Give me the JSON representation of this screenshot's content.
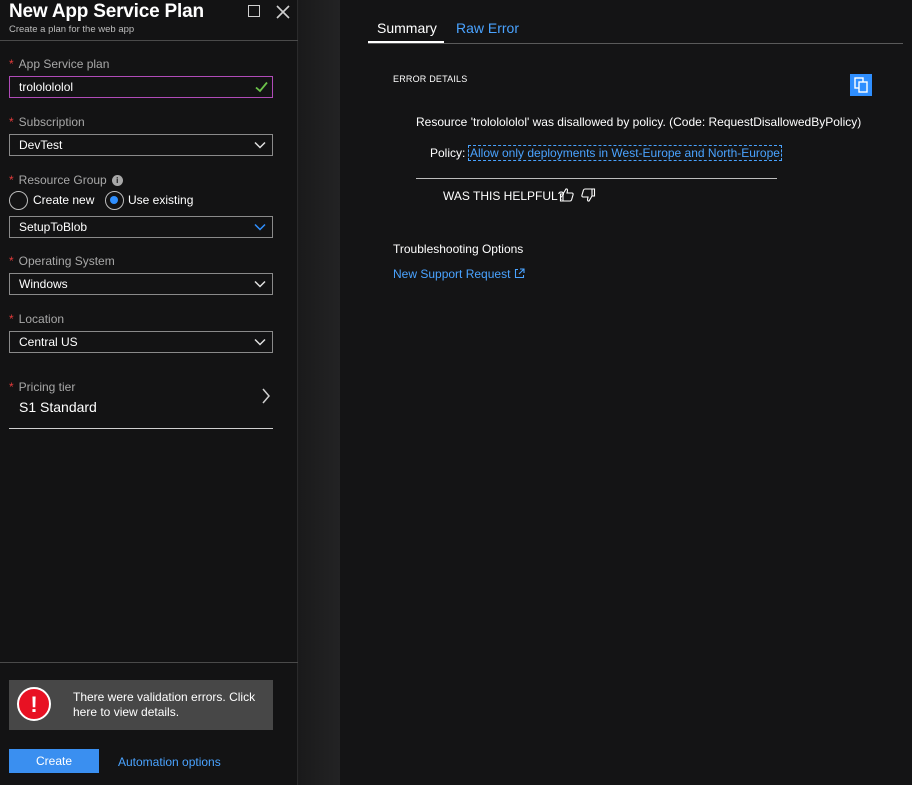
{
  "blade": {
    "title": "New App Service Plan",
    "subtitle": "Create a plan for the web app"
  },
  "form": {
    "plan_name": {
      "label": "App Service plan",
      "value": "trololololol"
    },
    "subscription": {
      "label": "Subscription",
      "value": "DevTest"
    },
    "resource_group": {
      "label": "Resource Group",
      "info_icon": "i",
      "option_new": "Create new",
      "option_existing": "Use existing",
      "selected": "Use existing",
      "value": "SetupToBlob"
    },
    "os": {
      "label": "Operating System",
      "value": "Windows"
    },
    "location": {
      "label": "Location",
      "value": "Central US"
    },
    "pricing": {
      "label": "Pricing tier",
      "value": "S1 Standard"
    },
    "required_marker": "*"
  },
  "validation": {
    "icon": "!",
    "message": "There were validation errors. Click here to view details."
  },
  "footer": {
    "create_label": "Create",
    "automation_label": "Automation options"
  },
  "details": {
    "tabs": [
      "Summary",
      "Raw Error"
    ],
    "active_tab": "Summary",
    "error_heading": "ERROR DETAILS",
    "resource_message": "Resource 'trololololol' was disallowed by policy. (Code: RequestDisallowedByPolicy)",
    "policy_label": "Policy:",
    "policy_link": "Allow only deployments in West-Europe and North-Europe",
    "helpful_label": "WAS THIS HELPFUL?",
    "troubleshooting_heading": "Troubleshooting Options",
    "support_link": "New Support Request"
  },
  "colors": {
    "accent": "#2f8fff",
    "link": "#4aa3ff",
    "error": "#e81123",
    "active_border": "#b04bb8",
    "valid_check": "#6cc24a"
  }
}
